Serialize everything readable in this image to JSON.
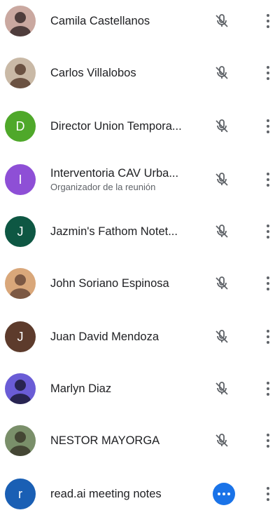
{
  "participants": [
    {
      "name": "Camila Castellanos",
      "subtitle": "",
      "avatar": {
        "type": "photo",
        "colors": [
          "#caa8a0",
          "#3a2a2a"
        ]
      },
      "mic": "muted"
    },
    {
      "name": "Carlos Villalobos",
      "subtitle": "",
      "avatar": {
        "type": "photo",
        "colors": [
          "#c9b9a6",
          "#5b4030"
        ]
      },
      "mic": "muted"
    },
    {
      "name": "Director Union Tempora...",
      "subtitle": "",
      "avatar": {
        "type": "letter",
        "letter": "D",
        "bg": "#4fa82a"
      },
      "mic": "muted"
    },
    {
      "name": "Interventoria CAV Urba...",
      "subtitle": "Organizador de la reunión",
      "avatar": {
        "type": "letter",
        "letter": "I",
        "bg": "#8e4fd6"
      },
      "mic": "muted"
    },
    {
      "name": "Jazmin's Fathom Notet...",
      "subtitle": "",
      "avatar": {
        "type": "letter",
        "letter": "J",
        "bg": "#0e5743"
      },
      "mic": "muted"
    },
    {
      "name": "John Soriano Espinosa",
      "subtitle": "",
      "avatar": {
        "type": "photo",
        "colors": [
          "#d9a77a",
          "#6b4a3a"
        ]
      },
      "mic": "muted"
    },
    {
      "name": "Juan David Mendoza",
      "subtitle": "",
      "avatar": {
        "type": "letter",
        "letter": "J",
        "bg": "#5d3b2c"
      },
      "mic": "muted"
    },
    {
      "name": "Marlyn Diaz",
      "subtitle": "",
      "avatar": {
        "type": "photo",
        "colors": [
          "#6a5cd6",
          "#1c1a3a"
        ]
      },
      "mic": "muted"
    },
    {
      "name": "NESTOR MAYORGA",
      "subtitle": "",
      "avatar": {
        "type": "photo",
        "colors": [
          "#7a8f6a",
          "#3b3a2a"
        ]
      },
      "mic": "muted"
    },
    {
      "name": "read.ai meeting notes",
      "subtitle": "",
      "avatar": {
        "type": "letter",
        "letter": "r",
        "bg": "#1a5fb4"
      },
      "mic": "speaking"
    }
  ],
  "icons": {
    "mic_muted": "mic-off-icon",
    "more": "more-vert-icon",
    "speaking": "speaking-indicator-icon"
  },
  "colors": {
    "icon_gray": "#5f6368",
    "accent": "#1a73e8",
    "text": "#202124"
  }
}
